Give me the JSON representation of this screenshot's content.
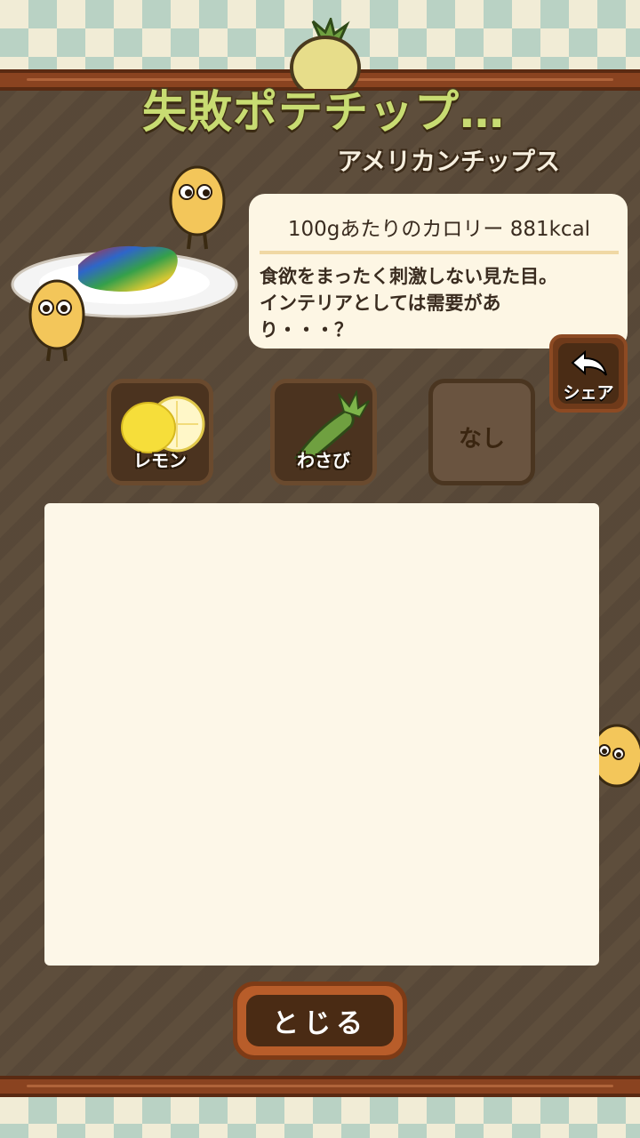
{
  "title": "失敗ポテチップ…",
  "subtitle": "アメリカンチップス",
  "info": {
    "calorie": "100gあたりのカロリー 881kcal",
    "description": "食欲をまったく刺激しない見た目。\nインテリアとしては需要があ\nり・・・？"
  },
  "share_label": "シェア",
  "toppings": [
    {
      "label": "レモン",
      "icon": "lemon-icon"
    },
    {
      "label": "わさび",
      "icon": "wasabi-icon"
    },
    {
      "label": "なし",
      "icon": "none"
    }
  ],
  "close_label": "とじる",
  "colors": {
    "panel": "#5e4e3c",
    "rail": "#8a4320",
    "title": "#c8dc72",
    "card": "#fdf6e4"
  }
}
